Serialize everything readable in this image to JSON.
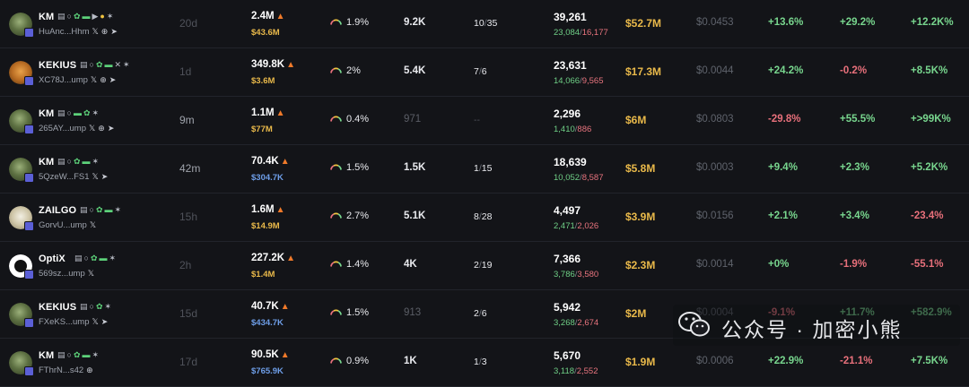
{
  "rows": [
    {
      "name": "KM",
      "icons": [
        "doc",
        "search",
        "leaf",
        "pill",
        "horn",
        "people",
        "bug"
      ],
      "address": "HuAnc...Hhm",
      "socials": [
        "x",
        "web",
        "tg"
      ],
      "age": "20d",
      "mcap": "2.4M",
      "liquidity": "$43.6M",
      "liq_color": "yellow",
      "gauge": "1.9%",
      "holders": "9.2K",
      "ratio_a": "10",
      "ratio_b": "35",
      "txns": "39,261",
      "buys": "23,084",
      "sells": "16,177",
      "volume": "$52.7M",
      "price": "$0.0453",
      "ch1": "+13.6%",
      "ch2": "+29.2%",
      "ch3": "+12.2K%",
      "avatar": "ca"
    },
    {
      "name": "KEKIUS",
      "icons": [
        "doc",
        "search",
        "leaf",
        "pill",
        "cross",
        "bug"
      ],
      "address": "XC78J...ump",
      "socials": [
        "x",
        "web",
        "tg"
      ],
      "age": "1d",
      "mcap": "349.8K",
      "liquidity": "$3.6M",
      "liq_color": "yellow",
      "gauge": "2%",
      "holders": "5.4K",
      "ratio_a": "7",
      "ratio_b": "6",
      "txns": "23,631",
      "buys": "14,066",
      "sells": "9,565",
      "volume": "$17.3M",
      "price": "$0.0044",
      "ch1": "+24.2%",
      "ch2": "-0.2%",
      "ch3": "+8.5K%",
      "avatar": "cb"
    },
    {
      "name": "KM",
      "icons": [
        "doc",
        "search",
        "pill",
        "leaf",
        "bug"
      ],
      "address": "265AY...ump",
      "socials": [
        "x",
        "web",
        "tg"
      ],
      "age": "9m",
      "mcap": "1.1M",
      "liquidity": "$77M",
      "liq_color": "yellow",
      "gauge": "0.4%",
      "holders": "971",
      "ratio_a": "--",
      "ratio_b": "",
      "txns": "2,296",
      "buys": "1,410",
      "sells": "886",
      "volume": "$6M",
      "price": "$0.0803",
      "ch1": "-29.8%",
      "ch2": "+55.5%",
      "ch3": "+>99K%",
      "avatar": "ca",
      "dim": true,
      "age_bright": true
    },
    {
      "name": "KM",
      "icons": [
        "doc",
        "search",
        "leaf",
        "pill",
        "bug"
      ],
      "address": "5QzeW...FS1",
      "socials": [
        "x",
        "tg"
      ],
      "age": "42m",
      "mcap": "70.4K",
      "liquidity": "$304.7K",
      "liq_color": "blue",
      "gauge": "1.5%",
      "holders": "1.5K",
      "ratio_a": "1",
      "ratio_b": "15",
      "txns": "18,639",
      "buys": "10,052",
      "sells": "8,587",
      "volume": "$5.8M",
      "price": "$0.0003",
      "ch1": "+9.4%",
      "ch2": "+2.3%",
      "ch3": "+5.2K%",
      "avatar": "ca",
      "age_bright": true
    },
    {
      "name": "ZAILGO",
      "icons": [
        "doc",
        "search",
        "leaf",
        "pill",
        "bug"
      ],
      "address": "GorvU...ump",
      "socials": [
        "x"
      ],
      "age": "15h",
      "mcap": "1.6M",
      "liquidity": "$14.9M",
      "liq_color": "yellow",
      "gauge": "2.7%",
      "holders": "5.1K",
      "ratio_a": "8",
      "ratio_b": "28",
      "txns": "4,497",
      "buys": "2,471",
      "sells": "2,026",
      "volume": "$3.9M",
      "price": "$0.0156",
      "ch1": "+2.1%",
      "ch2": "+3.4%",
      "ch3": "-23.4%",
      "avatar": "cc"
    },
    {
      "name": "OptiX",
      "icons": [
        "doc",
        "search",
        "leaf",
        "pill",
        "bug"
      ],
      "address": "569sz...ump",
      "socials": [
        "x"
      ],
      "age": "2h",
      "mcap": "227.2K",
      "liquidity": "$1.4M",
      "liq_color": "yellow",
      "gauge": "1.4%",
      "holders": "4K",
      "ratio_a": "2",
      "ratio_b": "19",
      "txns": "7,366",
      "buys": "3,786",
      "sells": "3,580",
      "volume": "$2.3M",
      "price": "$0.0014",
      "ch1": "+0%",
      "ch2": "-1.9%",
      "ch3": "-55.1%",
      "avatar": "cd"
    },
    {
      "name": "KEKIUS",
      "icons": [
        "doc",
        "search",
        "leaf",
        "bug"
      ],
      "address": "FXeKS...ump",
      "socials": [
        "x",
        "tg"
      ],
      "age": "15d",
      "mcap": "40.7K",
      "liquidity": "$434.7K",
      "liq_color": "blue",
      "gauge": "1.5%",
      "holders": "913",
      "ratio_a": "2",
      "ratio_b": "6",
      "txns": "5,942",
      "buys": "3,268",
      "sells": "2,674",
      "volume": "$2M",
      "price": "$0.0004",
      "ch1": "-9.1%",
      "ch2": "+11.7%",
      "ch3": "+582.9%",
      "avatar": "ca",
      "holders_dim": true
    },
    {
      "name": "KM",
      "icons": [
        "doc",
        "search",
        "leaf",
        "pill",
        "bug"
      ],
      "address": "FThrN...s42",
      "socials": [
        "web"
      ],
      "age": "17d",
      "mcap": "90.5K",
      "liquidity": "$765.9K",
      "liq_color": "blue",
      "gauge": "0.9%",
      "holders": "1K",
      "ratio_a": "1",
      "ratio_b": "3",
      "txns": "5,670",
      "buys": "3,118",
      "sells": "2,552",
      "volume": "$1.9M",
      "price": "$0.0006",
      "ch1": "+22.9%",
      "ch2": "-21.1%",
      "ch3": "+7.5K%",
      "avatar": "ca"
    }
  ],
  "icon_glyphs": {
    "doc": "▤",
    "search": "○",
    "leaf": "✿",
    "pill": "▬",
    "horn": "▶",
    "people": "●",
    "bug": "✶",
    "cross": "✕"
  },
  "social_glyphs": {
    "x": "𝕏",
    "web": "⊕",
    "tg": "➤"
  },
  "watermark": {
    "text": "公众号 · 加密小熊"
  },
  "colors": {
    "positive": "#78d68e",
    "negative": "#e8707b",
    "liquidity_yellow": "#e9b94a",
    "liquidity_blue": "#6e9ee8",
    "background": "#131418"
  }
}
